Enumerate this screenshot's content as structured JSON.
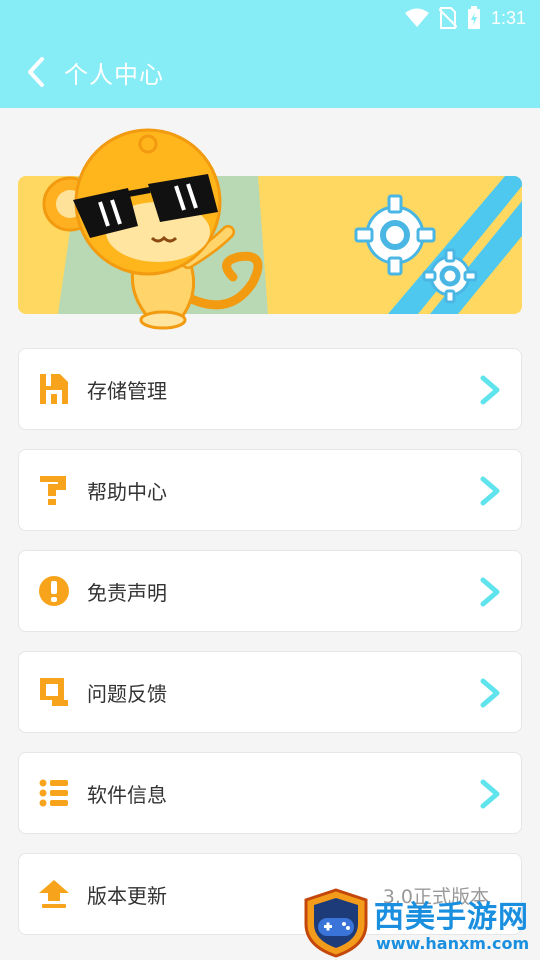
{
  "status_bar": {
    "time": "1:31"
  },
  "header": {
    "title": "个人中心"
  },
  "menu": [
    {
      "label": "存储管理",
      "icon": "storage-icon"
    },
    {
      "label": "帮助中心",
      "icon": "help-icon"
    },
    {
      "label": "免责声明",
      "icon": "disclaimer-icon"
    },
    {
      "label": "问题反馈",
      "icon": "feedback-icon"
    },
    {
      "label": "软件信息",
      "icon": "info-list-icon"
    },
    {
      "label": "版本更新",
      "icon": "update-icon",
      "extra": "3.0正式版本"
    }
  ],
  "watermark": {
    "text": "西美手游网",
    "url": "www.hanxm.com"
  },
  "colors": {
    "header": "#86ecf6",
    "accent": "#f7a41c",
    "chevron": "#5fe3ec",
    "banner": "#ffd862"
  }
}
